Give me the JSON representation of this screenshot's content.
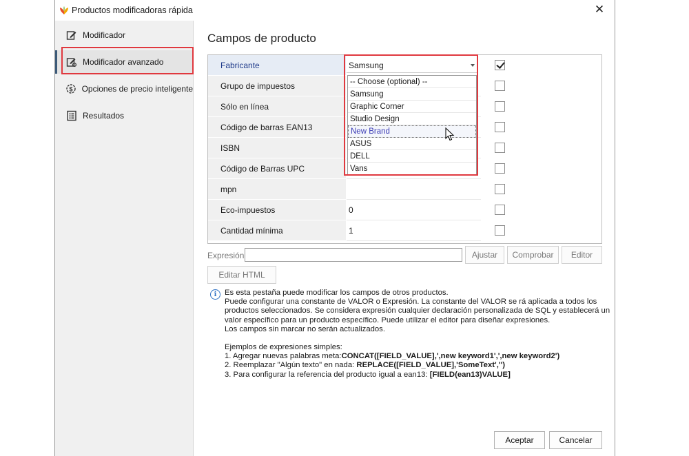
{
  "window": {
    "title": "Productos modificadoras rápida",
    "close_glyph": "✕"
  },
  "sidebar": {
    "items": [
      {
        "label": "Modificador",
        "icon": "edit-icon"
      },
      {
        "label": "Modificador avanzado",
        "icon": "advanced-edit-icon"
      },
      {
        "label": "Opciones de precio inteligente",
        "icon": "smart-price-icon"
      },
      {
        "label": "Resultados",
        "icon": "results-icon"
      }
    ],
    "active_index": 1
  },
  "main": {
    "title": "Campos de producto",
    "fields": [
      {
        "name": "Fabricante",
        "value": "Samsung",
        "checked": true
      },
      {
        "name": "Grupo de impuestos",
        "value": "",
        "checked": false
      },
      {
        "name": "Sólo en línea",
        "value": "",
        "checked": false
      },
      {
        "name": "Código de barras EAN13",
        "value": "",
        "checked": false
      },
      {
        "name": "ISBN",
        "value": "",
        "checked": false
      },
      {
        "name": "Código de Barras UPC",
        "value": "",
        "checked": false
      },
      {
        "name": "mpn",
        "value": "",
        "checked": false
      },
      {
        "name": "Eco-impuestos",
        "value": "0",
        "checked": false
      },
      {
        "name": "Cantidad mínima",
        "value": "1",
        "checked": false
      }
    ],
    "dropdown": {
      "options": [
        "-- Choose (optional) --",
        "Samsung",
        "Graphic Corner",
        "Studio Design",
        "New Brand",
        "ASUS",
        "DELL",
        "Vans"
      ],
      "hover_index": 4
    },
    "expression": {
      "label": "Expresión",
      "value": "",
      "buttons": {
        "adjust": "Ajustar",
        "check": "Comprobar",
        "editor": "Editor"
      },
      "edit_html": "Editar HTML"
    },
    "info": {
      "line1": "Es esta pestaña puede modificar los campos de otros productos.",
      "line2": "Puede configurar una constante de VALOR o Expresión. La constante del VALOR se rá aplicada a todos los",
      "line3": "productos seleccionados. Se considera expresión cualquier declaración personalizada de SQL y establecerá un",
      "line4": "valor específico para un producto específico. Puede utilizar el editor para diseñar expresiones.",
      "line5": "Los campos sin marcar no serán actualizados.",
      "examples_title": "Ejemplos de expresiones simples:",
      "ex1_text": "1. Agregar nuevas palabras meta:",
      "ex1_code": "CONCAT([FIELD_VALUE],',new keyword1',',new keyword2')",
      "ex2_text": "2. Reemplazar \"Algún texto\" en nada: ",
      "ex2_code": "REPLACE([FIELD_VALUE],'SomeText','')",
      "ex3_text": "3. Para configurar la referencia del producto igual a ean13: ",
      "ex3_code": "[FIELD(ean13)VALUE]"
    },
    "footer": {
      "accept": "Aceptar",
      "cancel": "Cancelar"
    }
  },
  "colors": {
    "highlight": "#e0383e",
    "selected_text": "#1f3a8a",
    "info_blue": "#2f72c4"
  }
}
